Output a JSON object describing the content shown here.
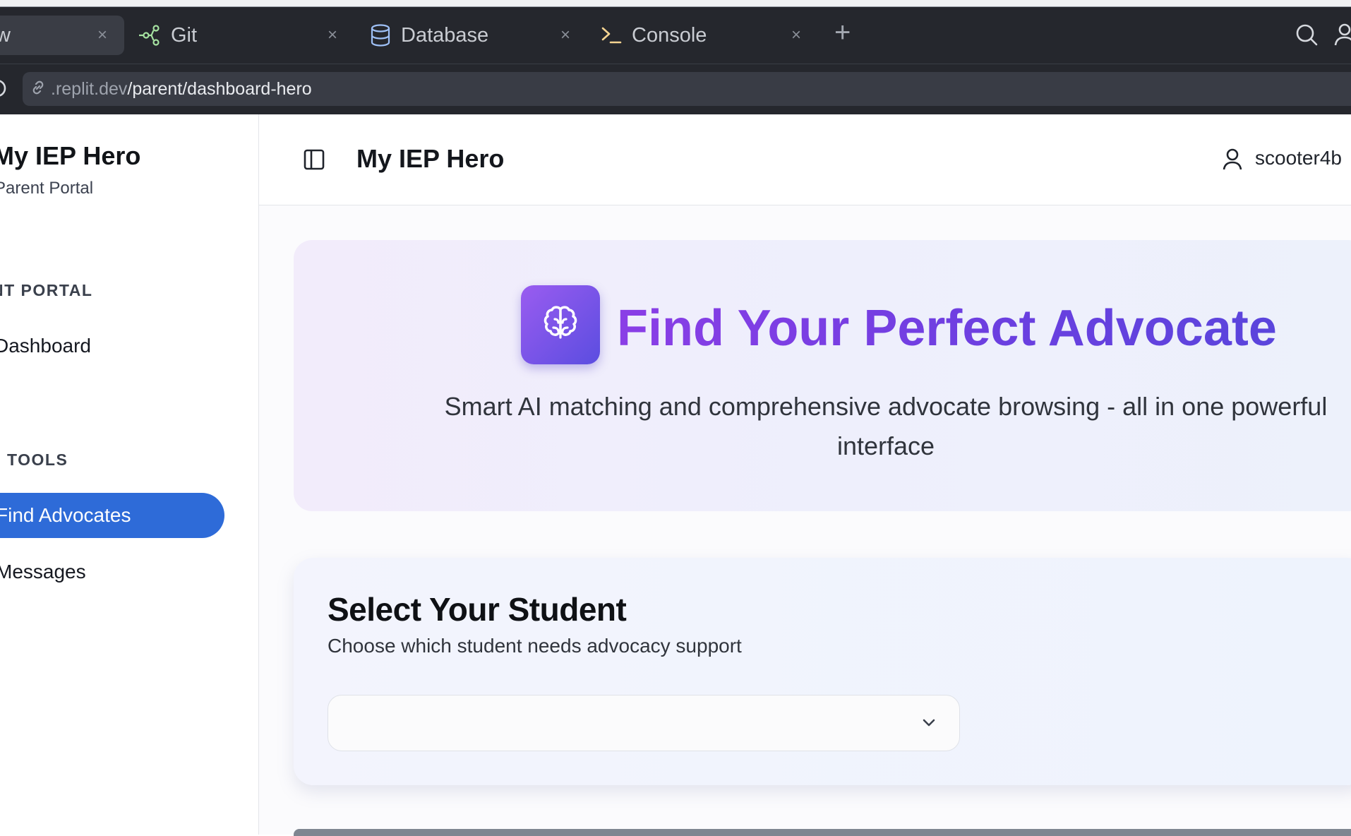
{
  "browser": {
    "tabs": [
      {
        "label": "w",
        "active": true
      },
      {
        "label": "Git",
        "icon": "git-icon"
      },
      {
        "label": "Database",
        "icon": "database-icon"
      },
      {
        "label": "Console",
        "icon": "console-icon"
      }
    ],
    "new_tab_label": "+",
    "close_label": "×",
    "url_dim": ".replit.dev",
    "url_path": "/parent/dashboard-hero"
  },
  "sidebar": {
    "app_title": "My IEP Hero",
    "app_subtitle": "Parent Portal",
    "section_portal": "NT PORTAL",
    "item_dashboard": "Dashboard",
    "section_tools": "TOOLS",
    "item_find": "Find Advocates",
    "item_messages": "Messages"
  },
  "header": {
    "title": "My IEP Hero",
    "username": "scooter4b"
  },
  "hero": {
    "title": "Find Your Perfect Advocate",
    "subtitle": "Smart AI matching and comprehensive advocate browsing - all in one powerful interface"
  },
  "student_selector": {
    "title": "Select Your Student",
    "subtitle": "Choose which student needs advocacy support",
    "selected_value": ""
  },
  "colors": {
    "accent_blue": "#2e6bd8",
    "hero_purple": "#7c3aed",
    "tabbar_bg": "#25272d"
  }
}
